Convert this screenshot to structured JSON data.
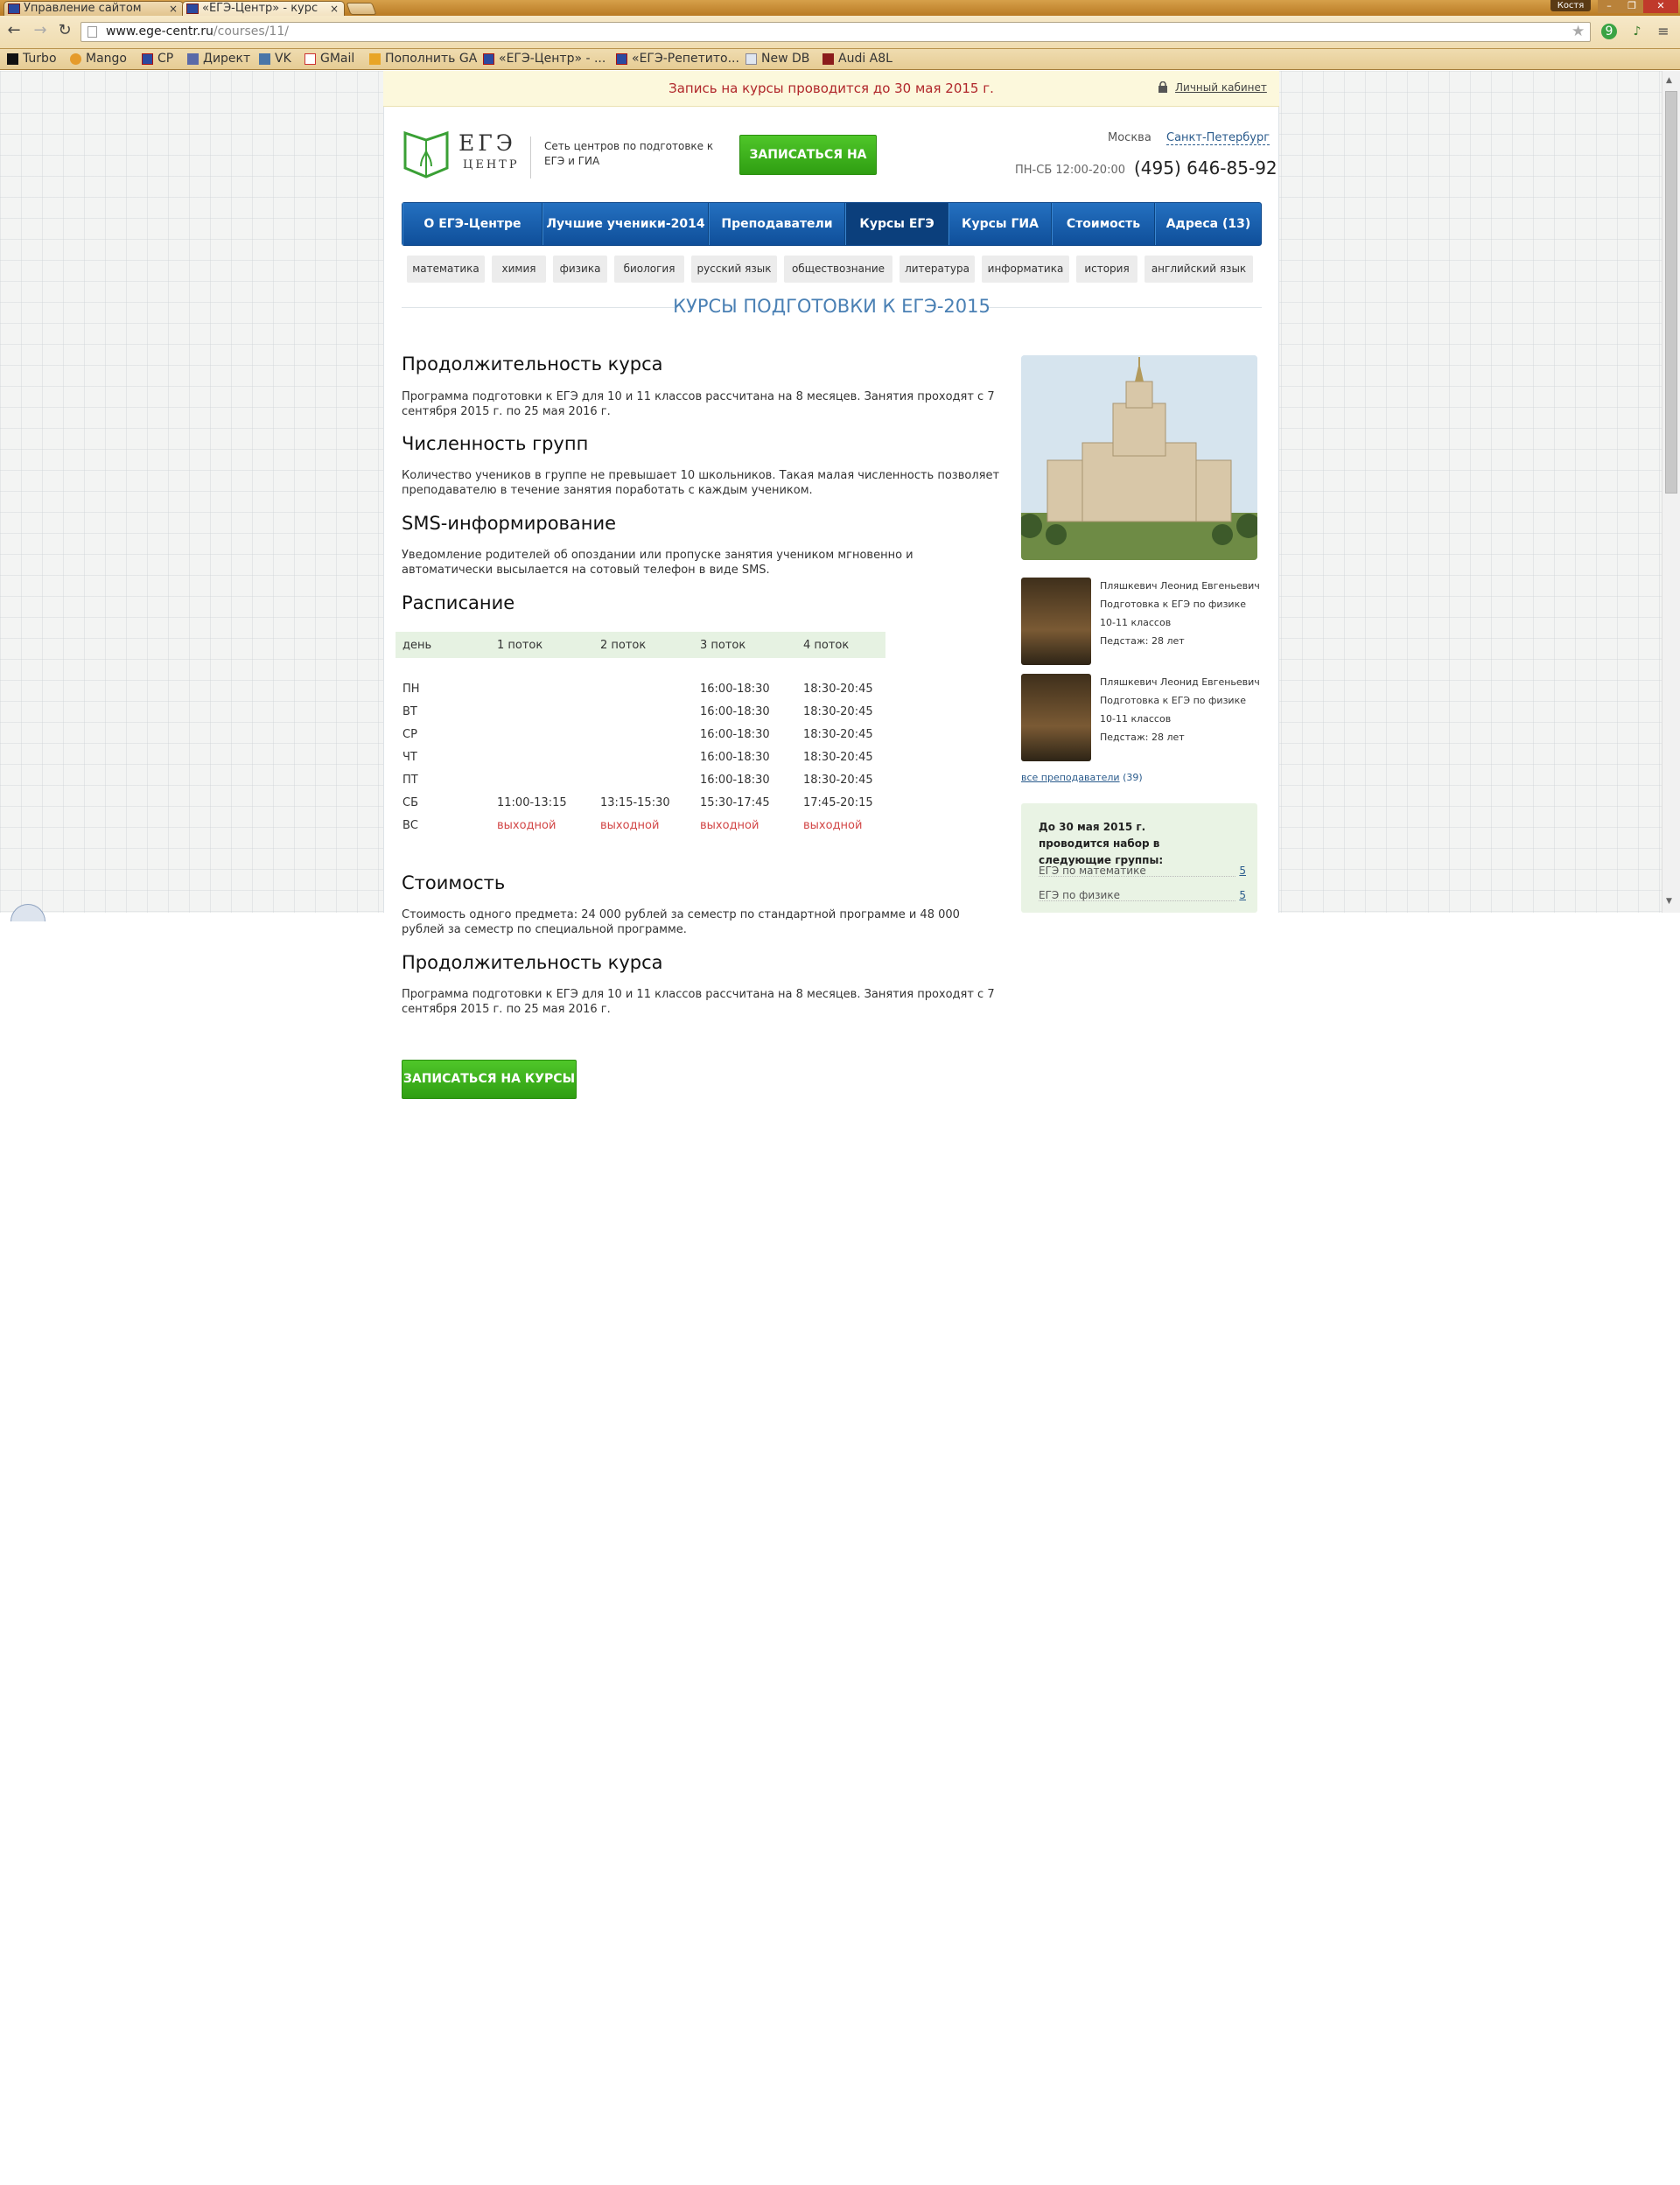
{
  "browser": {
    "tabs": [
      {
        "title": "Управление сайтом"
      },
      {
        "title": "«ЕГЭ-Центр» - курс"
      }
    ],
    "user_badge": "Костя",
    "url_host": "www.ege-centr.ru",
    "url_path": "/courses/11/",
    "bookmarks": [
      "Turbo",
      "Mango",
      "CP",
      "Директ",
      "VK",
      "GMail",
      "Пополнить GA",
      "«ЕГЭ-Центр» - ...",
      "«ЕГЭ-Репетито...",
      "New DB",
      "Audi A8L"
    ]
  },
  "site": {
    "topbar_message": "Запись на курсы проводится до 30 мая 2015 г.",
    "cabinet": "Личный кабинет",
    "logo_title": "ЕГЭ",
    "logo_sub": "ЦЕНТР",
    "tagline": "Сеть центров по подготовке к ЕГЭ и ГИА",
    "signup_label": "ЗАПИСАТЬСЯ НА КУРСЫ",
    "city_moscow": "Москва",
    "city_spb": "Санкт-Петербург",
    "hours": "ПН-СБ 12:00-20:00",
    "phone": "(495) 646-85-92",
    "nav": [
      "О ЕГЭ-Центре",
      "Лучшие ученики-2014",
      "Преподаватели",
      "Курсы ЕГЭ",
      "Курсы ГИА",
      "Стоимость",
      "Адреса (13)"
    ],
    "subjects": [
      "математика",
      "химия",
      "физика",
      "биология",
      "русский язык",
      "обществознание",
      "литература",
      "информатика",
      "история",
      "английский язык"
    ],
    "section_title": "КУРСЫ ПОДГОТОВКИ К ЕГЭ-2015"
  },
  "content": {
    "duration_title": "Продолжительность курса",
    "duration_text": "Программа подготовки к ЕГЭ для 10 и 11 классов рассчитана на 8 месяцев. Занятия проходят с 7 сентября 2015 г. по 25 мая 2016 г.",
    "groups_title": "Численность групп",
    "groups_text": "Количество учеников в группе не превышает 10 школьников. Такая малая численность позволяет преподавателю в течение занятия поработать с каждым учеником.",
    "sms_title": "SMS-информирование",
    "sms_text": "Уведомление родителей об опоздании или пропуске занятия учеником мгновенно и автоматически высылается на сотовый телефон в виде SMS.",
    "schedule_title": "Расписание",
    "schedule_head": [
      "день",
      "1 поток",
      "2 поток",
      "3 поток",
      "4 поток"
    ],
    "schedule_rows": [
      [
        "ПН",
        "",
        "",
        "16:00-18:30",
        "18:30-20:45"
      ],
      [
        "ВТ",
        "",
        "",
        "16:00-18:30",
        "18:30-20:45"
      ],
      [
        "СР",
        "",
        "",
        "16:00-18:30",
        "18:30-20:45"
      ],
      [
        "ЧТ",
        "",
        "",
        "16:00-18:30",
        "18:30-20:45"
      ],
      [
        "ПТ",
        "",
        "",
        "16:00-18:30",
        "18:30-20:45"
      ],
      [
        "СБ",
        "11:00-13:15",
        "13:15-15:30",
        "15:30-17:45",
        "17:45-20:15"
      ],
      [
        "ВС",
        "выходной",
        "выходной",
        "выходной",
        "выходной"
      ]
    ],
    "cost_title": "Стоимость",
    "cost_text": "Стоимость одного предмета: 24 000 рублей за семестр по стандартной программе и 48 000 рублей за семестр по специальной программе.",
    "duration2_title": "Продолжительность курса",
    "duration2_text": "Программа подготовки к ЕГЭ для 10 и 11 классов рассчитана на 8 месяцев. Занятия проходят с 7 сентября 2015 г. по 25 мая 2016 г.",
    "signup_bottom": "ЗАПИСАТЬСЯ НА КУРСЫ"
  },
  "sidebar": {
    "teachers": [
      {
        "name": "Пляшкевич Леонид Евгеньевич",
        "subject": "Подготовка к ЕГЭ по физике",
        "classes": "10-11 классов",
        "experience": "Педстаж: 28 лет"
      },
      {
        "name": "Пляшкевич Леонид Евгеньевич",
        "subject": "Подготовка к ЕГЭ по физике",
        "classes": "10-11 классов",
        "experience": "Педстаж: 28 лет"
      }
    ],
    "all_teachers": "все преподаватели",
    "all_teachers_count": "(39)",
    "groups_title": "До 30 мая 2015 г. проводится набор в следующие группы:",
    "groups": [
      {
        "label": "ЕГЭ по математике",
        "count": "5"
      },
      {
        "label": "ЕГЭ по физике",
        "count": "5"
      }
    ]
  }
}
